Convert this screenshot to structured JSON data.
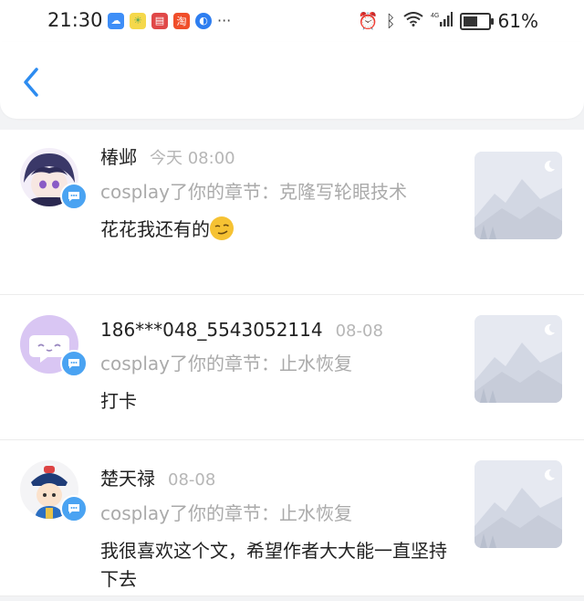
{
  "status_bar": {
    "time": "21:30",
    "battery": "61%",
    "battery_level": 0.61,
    "network": "4G"
  },
  "header": {
    "back_icon": "chevron-left-icon",
    "accent_color": "#2d8cf0"
  },
  "messages": [
    {
      "name": "椿邺",
      "time": "今天 08:00",
      "reply": "cosplay了你的章节：克隆写轮眼技术",
      "body": "花花我还有的"
    },
    {
      "name": "186***048_5543052114",
      "time": "08-08",
      "reply": "cosplay了你的章节：止水恢复",
      "body": "打卡"
    },
    {
      "name": "楚天禄",
      "time": "08-08",
      "reply": "cosplay了你的章节：止水恢复",
      "body": "我很喜欢这个文，希望作者大大能一直坚持下去"
    }
  ]
}
